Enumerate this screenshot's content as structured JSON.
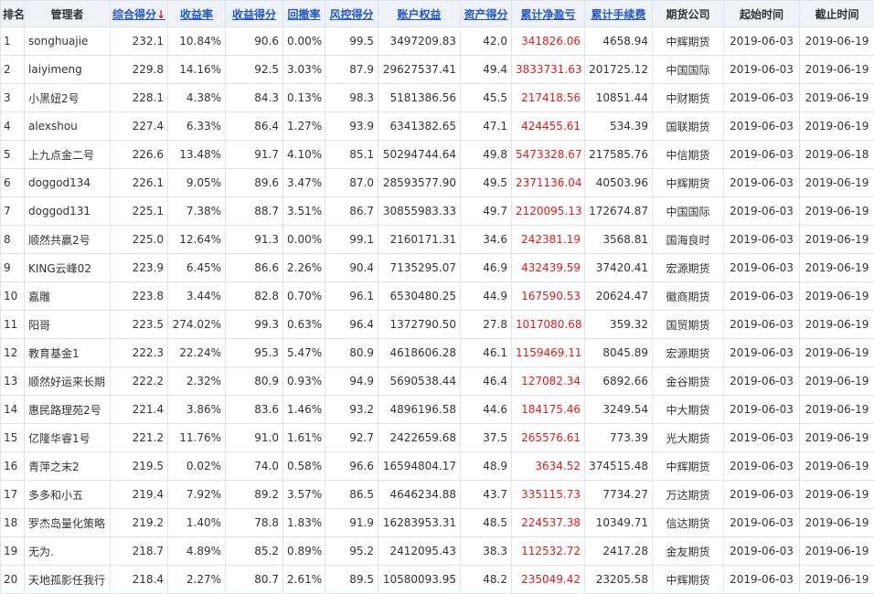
{
  "headers": {
    "rank": "排名",
    "manager": "管理者",
    "total_score": "综合得分",
    "sort_arrow": "↓",
    "return_rate": "收益率",
    "return_score": "收益得分",
    "drawdown": "回撤率",
    "risk_score": "风控得分",
    "equity": "账户权益",
    "asset_score": "资产得分",
    "net_pnl": "累计净盈亏",
    "fees": "累计手续费",
    "broker": "期货公司",
    "start_time": "起始时间",
    "end_time": "截止时间"
  },
  "rows": [
    {
      "rank": "1",
      "manager": "songhuajie",
      "score": "232.1",
      "ret": "10.84%",
      "ret_score": "90.6",
      "dd": "0.00%",
      "risk": "99.5",
      "equity": "3497209.83",
      "asset": "42.0",
      "pnl": "341826.06",
      "fee": "4658.94",
      "broker": "中辉期货",
      "start": "2019-06-03",
      "end": "2019-06-19"
    },
    {
      "rank": "2",
      "manager": "laiyimeng",
      "score": "229.8",
      "ret": "14.16%",
      "ret_score": "92.5",
      "dd": "3.03%",
      "risk": "87.9",
      "equity": "29627537.41",
      "asset": "49.4",
      "pnl": "3833731.63",
      "fee": "201725.12",
      "broker": "中国国际",
      "start": "2019-06-03",
      "end": "2019-06-19"
    },
    {
      "rank": "3",
      "manager": "小黑妞2号",
      "score": "228.1",
      "ret": "4.38%",
      "ret_score": "84.3",
      "dd": "0.13%",
      "risk": "98.3",
      "equity": "5181386.56",
      "asset": "45.5",
      "pnl": "217418.56",
      "fee": "10851.44",
      "broker": "中财期货",
      "start": "2019-06-03",
      "end": "2019-06-19"
    },
    {
      "rank": "4",
      "manager": "alexshou",
      "score": "227.4",
      "ret": "6.33%",
      "ret_score": "86.4",
      "dd": "1.27%",
      "risk": "93.9",
      "equity": "6341382.65",
      "asset": "47.1",
      "pnl": "424455.61",
      "fee": "534.39",
      "broker": "国联期货",
      "start": "2019-06-03",
      "end": "2019-06-19"
    },
    {
      "rank": "5",
      "manager": "上九点金二号",
      "score": "226.6",
      "ret": "13.48%",
      "ret_score": "91.7",
      "dd": "4.10%",
      "risk": "85.1",
      "equity": "50294744.64",
      "asset": "49.8",
      "pnl": "5473328.67",
      "fee": "217585.76",
      "broker": "中信期货",
      "start": "2019-06-03",
      "end": "2019-06-18"
    },
    {
      "rank": "6",
      "manager": "doggod134",
      "score": "226.1",
      "ret": "9.05%",
      "ret_score": "89.6",
      "dd": "3.47%",
      "risk": "87.0",
      "equity": "28593577.90",
      "asset": "49.5",
      "pnl": "2371136.04",
      "fee": "40503.96",
      "broker": "中辉期货",
      "start": "2019-06-03",
      "end": "2019-06-19"
    },
    {
      "rank": "7",
      "manager": "doggod131",
      "score": "225.1",
      "ret": "7.38%",
      "ret_score": "88.7",
      "dd": "3.51%",
      "risk": "86.7",
      "equity": "30855983.33",
      "asset": "49.7",
      "pnl": "2120095.13",
      "fee": "172674.87",
      "broker": "中国国际",
      "start": "2019-06-03",
      "end": "2019-06-19"
    },
    {
      "rank": "8",
      "manager": "顺然共赢2号",
      "score": "225.0",
      "ret": "12.64%",
      "ret_score": "91.3",
      "dd": "0.00%",
      "risk": "99.1",
      "equity": "2160171.31",
      "asset": "34.6",
      "pnl": "242381.19",
      "fee": "3568.81",
      "broker": "国海良时",
      "start": "2019-06-03",
      "end": "2019-06-19"
    },
    {
      "rank": "9",
      "manager": "KING云峰02",
      "score": "223.9",
      "ret": "6.45%",
      "ret_score": "86.6",
      "dd": "2.26%",
      "risk": "90.4",
      "equity": "7135295.07",
      "asset": "46.9",
      "pnl": "432439.59",
      "fee": "37420.41",
      "broker": "宏源期货",
      "start": "2019-06-03",
      "end": "2019-06-19"
    },
    {
      "rank": "10",
      "manager": "嘉雕",
      "score": "223.8",
      "ret": "3.44%",
      "ret_score": "82.8",
      "dd": "0.70%",
      "risk": "96.1",
      "equity": "6530480.25",
      "asset": "44.9",
      "pnl": "167590.53",
      "fee": "20624.47",
      "broker": "徽商期货",
      "start": "2019-06-03",
      "end": "2019-06-19"
    },
    {
      "rank": "11",
      "manager": "阳哥",
      "score": "223.5",
      "ret": "274.02%",
      "ret_score": "99.3",
      "dd": "0.63%",
      "risk": "96.4",
      "equity": "1372790.50",
      "asset": "27.8",
      "pnl": "1017080.68",
      "fee": "359.32",
      "broker": "国贸期货",
      "start": "2019-06-03",
      "end": "2019-06-19"
    },
    {
      "rank": "12",
      "manager": "教育基金1",
      "score": "222.3",
      "ret": "22.24%",
      "ret_score": "95.3",
      "dd": "5.47%",
      "risk": "80.9",
      "equity": "4618606.28",
      "asset": "46.1",
      "pnl": "1159469.11",
      "fee": "8045.89",
      "broker": "宏源期货",
      "start": "2019-06-03",
      "end": "2019-06-19"
    },
    {
      "rank": "13",
      "manager": "顺然好运来长期",
      "score": "222.2",
      "ret": "2.32%",
      "ret_score": "80.9",
      "dd": "0.93%",
      "risk": "94.9",
      "equity": "5690538.44",
      "asset": "46.4",
      "pnl": "127082.34",
      "fee": "6892.66",
      "broker": "金谷期货",
      "start": "2019-06-03",
      "end": "2019-06-19"
    },
    {
      "rank": "14",
      "manager": "惠民路理苑2号",
      "score": "221.4",
      "ret": "3.86%",
      "ret_score": "83.6",
      "dd": "1.46%",
      "risk": "93.2",
      "equity": "4896196.58",
      "asset": "44.6",
      "pnl": "184175.46",
      "fee": "3249.54",
      "broker": "中大期货",
      "start": "2019-06-03",
      "end": "2019-06-19"
    },
    {
      "rank": "15",
      "manager": "亿隆华睿1号",
      "score": "221.2",
      "ret": "11.76%",
      "ret_score": "91.0",
      "dd": "1.61%",
      "risk": "92.7",
      "equity": "2422659.68",
      "asset": "37.5",
      "pnl": "265576.61",
      "fee": "773.39",
      "broker": "光大期货",
      "start": "2019-06-03",
      "end": "2019-06-19"
    },
    {
      "rank": "16",
      "manager": "青萍之末2",
      "score": "219.5",
      "ret": "0.02%",
      "ret_score": "74.0",
      "dd": "0.58%",
      "risk": "96.6",
      "equity": "16594804.17",
      "asset": "48.9",
      "pnl": "3634.52",
      "fee": "374515.48",
      "broker": "中辉期货",
      "start": "2019-06-03",
      "end": "2019-06-19"
    },
    {
      "rank": "17",
      "manager": "多多和小五",
      "score": "219.4",
      "ret": "7.92%",
      "ret_score": "89.2",
      "dd": "3.57%",
      "risk": "86.5",
      "equity": "4646234.88",
      "asset": "43.7",
      "pnl": "335115.73",
      "fee": "7734.27",
      "broker": "万达期货",
      "start": "2019-06-03",
      "end": "2019-06-19"
    },
    {
      "rank": "18",
      "manager": "罗杰岛量化策略",
      "score": "219.2",
      "ret": "1.40%",
      "ret_score": "78.8",
      "dd": "1.83%",
      "risk": "91.9",
      "equity": "16283953.31",
      "asset": "48.5",
      "pnl": "224537.38",
      "fee": "10349.71",
      "broker": "信达期货",
      "start": "2019-06-03",
      "end": "2019-06-19"
    },
    {
      "rank": "19",
      "manager": "无为.",
      "score": "218.7",
      "ret": "4.89%",
      "ret_score": "85.2",
      "dd": "0.89%",
      "risk": "95.2",
      "equity": "2412095.43",
      "asset": "38.3",
      "pnl": "112532.72",
      "fee": "2417.28",
      "broker": "金友期货",
      "start": "2019-06-03",
      "end": "2019-06-19"
    },
    {
      "rank": "20",
      "manager": "天地孤影任我行",
      "score": "218.4",
      "ret": "2.27%",
      "ret_score": "80.7",
      "dd": "2.61%",
      "risk": "89.5",
      "equity": "10580093.95",
      "asset": "48.2",
      "pnl": "235049.42",
      "fee": "23205.58",
      "broker": "中辉期货",
      "start": "2019-06-03",
      "end": "2019-06-19"
    }
  ]
}
